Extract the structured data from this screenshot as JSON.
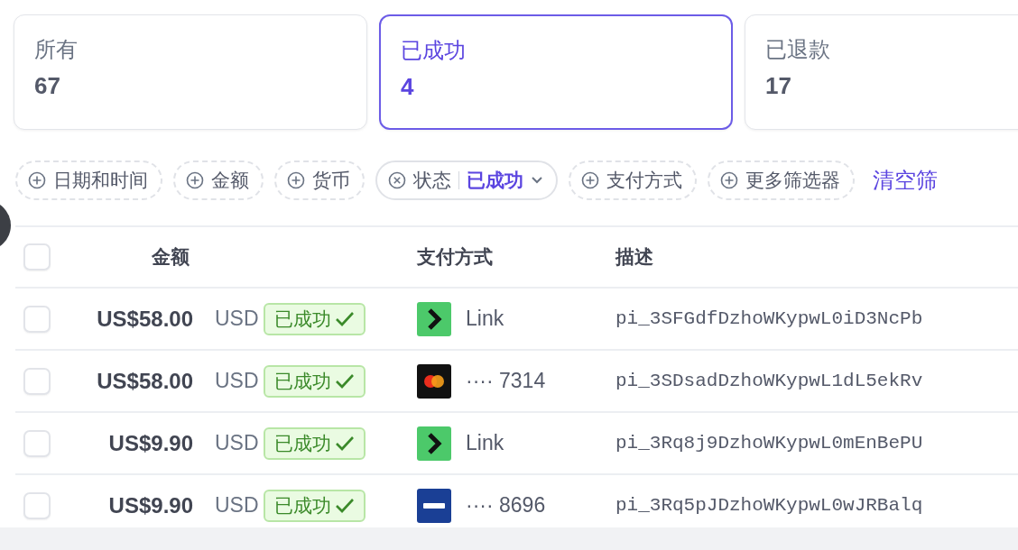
{
  "summary_cards": [
    {
      "label": "所有",
      "count": "67",
      "selected": false
    },
    {
      "label": "已成功",
      "count": "4",
      "selected": true
    },
    {
      "label": "已退款",
      "count": "17",
      "selected": false
    }
  ],
  "filters": [
    {
      "kind": "add",
      "label": "日期和时间"
    },
    {
      "kind": "add",
      "label": "金额"
    },
    {
      "kind": "add",
      "label": "货币"
    },
    {
      "kind": "set",
      "label": "状态",
      "value": "已成功"
    },
    {
      "kind": "add",
      "label": "支付方式"
    },
    {
      "kind": "add",
      "label": "更多筛选器"
    }
  ],
  "clear_link": "清空筛",
  "table": {
    "select_all_checked": false,
    "columns": [
      "金额",
      "支付方式",
      "描述"
    ],
    "rows": [
      {
        "checked": false,
        "amount": "US$58.00",
        "currency": "USD",
        "status": "已成功",
        "method": {
          "kind": "link",
          "text": "Link"
        },
        "description": "pi_3SFGdfDzhoWKypwL0iD3NcPb"
      },
      {
        "checked": false,
        "amount": "US$58.00",
        "currency": "USD",
        "status": "已成功",
        "method": {
          "kind": "mastercard",
          "text": "···· 7314"
        },
        "description": "pi_3SDsadDzhoWKypwL1dL5ekRv"
      },
      {
        "checked": false,
        "amount": "US$9.90",
        "currency": "USD",
        "status": "已成功",
        "method": {
          "kind": "link",
          "text": "Link"
        },
        "description": "pi_3Rq8j9DzhoWKypwL0mEnBePU"
      },
      {
        "checked": false,
        "amount": "US$9.90",
        "currency": "USD",
        "status": "已成功",
        "method": {
          "kind": "visa",
          "text": "···· 8696"
        },
        "description": "pi_3Rq5pJDzhoWKypwL0wJRBalq"
      }
    ]
  }
}
